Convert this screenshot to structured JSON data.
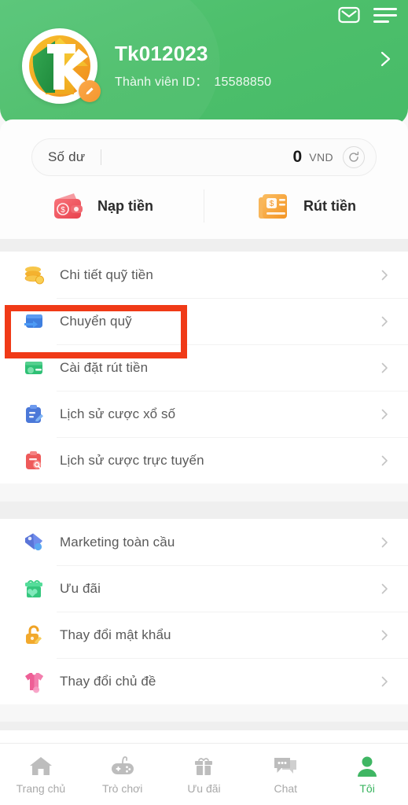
{
  "header": {
    "mail_icon": "mail-icon",
    "menu_icon": "hamburger-menu-icon",
    "avatar_icon": "avatar-logo",
    "avatar_badge_icon": "edit-pencil-icon",
    "username": "Tk012023",
    "member_id_label": "Thành viên ID：",
    "member_id_value": "15588850",
    "chevron_icon": "chevron-right-icon",
    "bg_color": "#4fc06a"
  },
  "balance": {
    "label": "Số dư",
    "amount": "0",
    "currency": "VND",
    "refresh_icon": "refresh-icon",
    "actions": [
      {
        "label": "Nạp tiền",
        "icon": "wallet-deposit-icon",
        "color": "#ef4a52"
      },
      {
        "label": "Rút tiền",
        "icon": "withdraw-bill-icon",
        "color": "#f5a033"
      }
    ]
  },
  "menu_groups": [
    {
      "items": [
        {
          "label": "Chi tiết quỹ tiền",
          "icon": "coin-stack-icon",
          "chevron": "chevron-right-icon",
          "highlighted": false
        },
        {
          "label": "Chuyển quỹ",
          "icon": "wallet-transfer-icon",
          "chevron": "chevron-right-icon",
          "highlighted": true
        },
        {
          "label": "Cài đặt rút tiền",
          "icon": "bank-card-icon",
          "chevron": "chevron-right-icon",
          "highlighted": false
        },
        {
          "label": "Lịch sử cược xổ số",
          "icon": "clipboard-pencil-icon",
          "chevron": "chevron-right-icon",
          "highlighted": false
        },
        {
          "label": "Lịch sử cược trực tuyến",
          "icon": "clipboard-search-icon",
          "chevron": "chevron-right-icon",
          "highlighted": false
        }
      ]
    },
    {
      "items": [
        {
          "label": "Marketing toàn cầu",
          "icon": "diamond-tag-icon",
          "chevron": "chevron-right-icon",
          "highlighted": false
        },
        {
          "label": "Ưu đãi",
          "icon": "gift-box-icon",
          "chevron": "chevron-right-icon",
          "highlighted": false
        },
        {
          "label": "Thay đổi mật khẩu",
          "icon": "padlock-pencil-icon",
          "chevron": "chevron-right-icon",
          "highlighted": false
        },
        {
          "label": "Thay đổi chủ đề",
          "icon": "tshirt-icon",
          "chevron": "chevron-right-icon",
          "highlighted": false
        }
      ]
    }
  ],
  "highlight": {
    "color": "#f03a17",
    "target_label": "Chuyển quỹ"
  },
  "tabbar": {
    "active_color": "#39b45f",
    "inactive_color": "#a9a9a9",
    "tabs": [
      {
        "label": "Trang chủ",
        "icon": "home-icon",
        "active": false
      },
      {
        "label": "Trò chơi",
        "icon": "gamepad-icon",
        "active": false
      },
      {
        "label": "Ưu đãi",
        "icon": "gift-icon",
        "active": false
      },
      {
        "label": "Chat",
        "icon": "chat-bubbles-icon",
        "active": false
      },
      {
        "label": "Tôi",
        "icon": "person-icon",
        "active": true
      }
    ]
  }
}
